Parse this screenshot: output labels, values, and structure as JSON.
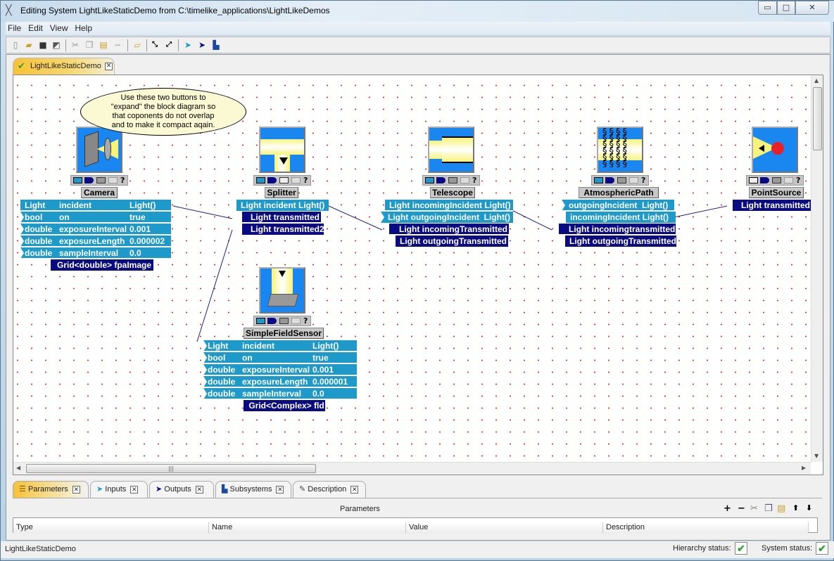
{
  "window": {
    "title": "Editing System LightLikeStaticDemo from C:\\timelike_applications\\LightLikeDemos",
    "controls": {
      "minimize": "▭",
      "maximize": "□",
      "close": "✕"
    }
  },
  "menu": [
    "File",
    "Edit",
    "View",
    "Help"
  ],
  "toolbar": {
    "buttons": [
      "new-file",
      "open-folder",
      "save",
      "save-all",
      "cut",
      "copy",
      "paste",
      "remove",
      "import",
      "compact-diagram",
      "expand-diagram",
      "add-input",
      "add-output",
      "add-subsystem"
    ]
  },
  "doc_tab": {
    "label": "LightLikeStaticDemo",
    "status_icon": "✔",
    "close": "✕"
  },
  "tooltip": {
    "lines": [
      "Use these two buttons to",
      "\"expand\" the block diagram so",
      "that coponents do not overlap",
      "and to make it compact aqain."
    ]
  },
  "blocks": {
    "camera": {
      "name": "Camera",
      "inputs": [
        {
          "type": "Light",
          "name": "incident",
          "value": "Light()"
        },
        {
          "type": "bool",
          "name": "on",
          "value": "true"
        },
        {
          "type": "double",
          "name": "exposureInterval",
          "value": "0.001"
        },
        {
          "type": "double",
          "name": "exposureLength",
          "value": "0.000002"
        },
        {
          "type": "double",
          "name": "sampleInterval",
          "value": "0.0"
        }
      ],
      "outputs": [
        "Grid<double> fpaImage"
      ]
    },
    "splitter": {
      "name": "Splitter",
      "inputs": [
        "Light incident Light()"
      ],
      "outputs": [
        "Light transmitted",
        "Light transmitted2"
      ]
    },
    "telescope": {
      "name": "Telescope",
      "inputs": [
        "Light incomingIncident Light()",
        "Light outgoingIncident  Light()"
      ],
      "outputs": [
        "Light incomingTransmitted",
        "Light outgoingTransmitted"
      ]
    },
    "atmospheric": {
      "name": "AtmosphericPath",
      "inputs": [
        "outgoingIncident  Light()",
        "incomingIncident Light()"
      ],
      "outputs": [
        "Light incomingtransmitted",
        "Light outgoingTransmitted"
      ]
    },
    "pointsource": {
      "name": "PointSource",
      "outputs": [
        "Light transmitted"
      ]
    },
    "sensor": {
      "name": "SimpleFieldSensor",
      "inputs": [
        {
          "type": "Light",
          "name": "incident",
          "value": "Light()"
        },
        {
          "type": "bool",
          "name": "on",
          "value": "true"
        },
        {
          "type": "double",
          "name": "exposureInterval",
          "value": "0.001"
        },
        {
          "type": "double",
          "name": "exposureLength",
          "value": "0.000001"
        },
        {
          "type": "double",
          "name": "sampleInterval",
          "value": "0.0"
        }
      ],
      "outputs": [
        "Grid<Complex> fld"
      ]
    }
  },
  "bottom_tabs": [
    {
      "label": "Parameters",
      "active": true
    },
    {
      "label": "Inputs",
      "active": false
    },
    {
      "label": "Outputs",
      "active": false
    },
    {
      "label": "Subsystems",
      "active": false
    },
    {
      "label": "Description",
      "active": false
    }
  ],
  "parameters_panel": {
    "title": "Parameters",
    "columns": [
      "Type",
      "Name",
      "Value",
      "Description"
    ],
    "rows": []
  },
  "status": {
    "left": "LightLikeStaticDemo",
    "hierarchy_label": "Hierarchy status:",
    "system_label": "System status:",
    "check": "✔"
  },
  "colors": {
    "input_port": "#1d9ac9",
    "output_port": "#0a0a82",
    "block_icon_bg": "#1a86f0",
    "active_tab": "#f7c236",
    "grid_dot": "#dd2222"
  }
}
